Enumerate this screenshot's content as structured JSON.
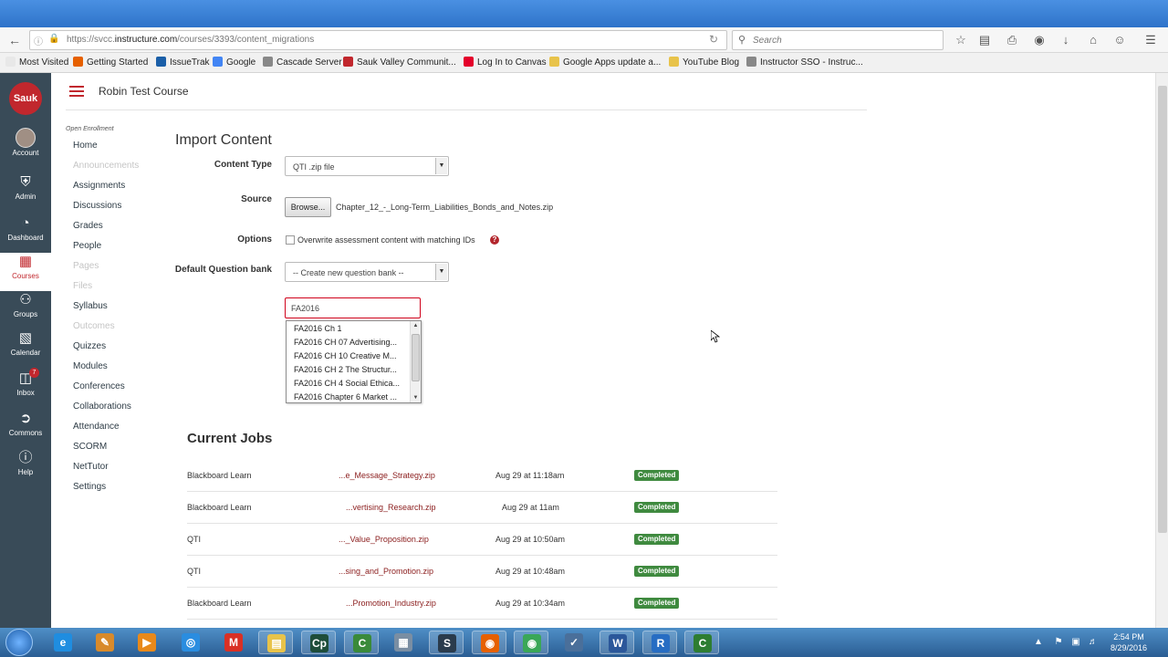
{
  "browser": {
    "url_prefix": "https://svcc.",
    "url_domain": "instructure.com",
    "url_path": "/courses/3393/content_migrations",
    "search_placeholder": "Search"
  },
  "bookmarks": [
    {
      "label": "Most Visited",
      "color": "#e8e8e8"
    },
    {
      "label": "Getting Started",
      "color": "#e66000"
    },
    {
      "label": "IssueTrak",
      "color": "#1b5fa8"
    },
    {
      "label": "Google",
      "color": "#4285f4"
    },
    {
      "label": "Cascade Server",
      "color": "#888888"
    },
    {
      "label": "Sauk Valley Communit...",
      "color": "#c1272d"
    },
    {
      "label": "Log In to Canvas",
      "color": "#e4002b"
    },
    {
      "label": "Google Apps update a...",
      "color": "#e8c34a"
    },
    {
      "label": "YouTube Blog",
      "color": "#e8c34a"
    },
    {
      "label": "Instructor SSO - Instruc...",
      "color": "#888888"
    }
  ],
  "global_nav": {
    "logo": "Sauk",
    "items": [
      {
        "label": "Account",
        "icon": "avatar"
      },
      {
        "label": "Admin",
        "icon": "shield-icon"
      },
      {
        "label": "Dashboard",
        "icon": "dashboard-icon"
      },
      {
        "label": "Courses",
        "icon": "book-icon"
      },
      {
        "label": "Groups",
        "icon": "groups-icon"
      },
      {
        "label": "Calendar",
        "icon": "calendar-icon"
      },
      {
        "label": "Inbox",
        "icon": "inbox-icon",
        "badge": "7"
      },
      {
        "label": "Commons",
        "icon": "commons-icon"
      },
      {
        "label": "Help",
        "icon": "help-icon"
      }
    ],
    "active": "Courses"
  },
  "course": {
    "title": "Robin Test Course",
    "enrollment_label": "Open Enrollment",
    "nav": [
      {
        "label": "Home",
        "disabled": false
      },
      {
        "label": "Announcements",
        "disabled": true
      },
      {
        "label": "Assignments",
        "disabled": false
      },
      {
        "label": "Discussions",
        "disabled": false
      },
      {
        "label": "Grades",
        "disabled": false
      },
      {
        "label": "People",
        "disabled": false
      },
      {
        "label": "Pages",
        "disabled": true
      },
      {
        "label": "Files",
        "disabled": true
      },
      {
        "label": "Syllabus",
        "disabled": false
      },
      {
        "label": "Outcomes",
        "disabled": true
      },
      {
        "label": "Quizzes",
        "disabled": false
      },
      {
        "label": "Modules",
        "disabled": false
      },
      {
        "label": "Conferences",
        "disabled": false
      },
      {
        "label": "Collaborations",
        "disabled": false
      },
      {
        "label": "Attendance",
        "disabled": false
      },
      {
        "label": "SCORM",
        "disabled": false
      },
      {
        "label": "NetTutor",
        "disabled": false
      },
      {
        "label": "Settings",
        "disabled": false
      }
    ]
  },
  "import": {
    "title": "Import Content",
    "content_type_label": "Content Type",
    "content_type_value": "QTI .zip file",
    "source_label": "Source",
    "browse_label": "Browse...",
    "file_name": "Chapter_12_-_Long-Term_Liabilities_Bonds_and_Notes.zip",
    "options_label": "Options",
    "overwrite_label": "Overwrite assessment content with matching IDs",
    "help_glyph": "?",
    "question_bank_label": "Default Question bank",
    "question_bank_value": "-- Create new question bank --",
    "new_bank_value": "FA2016",
    "suggestions": [
      "FA2016 Ch 1",
      "FA2016 CH 07 Advertising...",
      "FA2016 CH 10 Creative M...",
      "FA2016 CH 2 The Structur...",
      "FA2016 CH 4 Social Ethica...",
      "FA2016 Chapter 6 Market ..."
    ]
  },
  "jobs": {
    "title": "Current Jobs",
    "rows": [
      {
        "type": "Blackboard Learn",
        "file": "...e_Message_Strategy.zip",
        "date": "Aug 29 at 11:18am",
        "status": "Completed"
      },
      {
        "type": "Blackboard Learn",
        "file": "...vertising_Research.zip",
        "date": "Aug 29 at 11am",
        "status": "Completed"
      },
      {
        "type": "QTI",
        "file": "..._Value_Proposition.zip",
        "date": "Aug 29 at 10:50am",
        "status": "Completed"
      },
      {
        "type": "QTI",
        "file": "...sing_and_Promotion.zip",
        "date": "Aug 29 at 10:48am",
        "status": "Completed"
      },
      {
        "type": "Blackboard Learn",
        "file": "...Promotion_Industry.zip",
        "date": "Aug 29 at 10:34am",
        "status": "Completed"
      }
    ]
  },
  "taskbar": {
    "apps": [
      {
        "name": "ie-icon",
        "glyph": "e",
        "color": "#1f8de0"
      },
      {
        "name": "paint-icon",
        "glyph": "✎",
        "color": "#d88a2b"
      },
      {
        "name": "media-icon",
        "glyph": "▶",
        "color": "#e8891b"
      },
      {
        "name": "chat-icon",
        "glyph": "◎",
        "color": "#2a8de0"
      },
      {
        "name": "gmail-icon",
        "glyph": "M",
        "color": "#d93025"
      },
      {
        "name": "folder-icon",
        "glyph": "▤",
        "color": "#e8c34a"
      },
      {
        "name": "captivate-icon",
        "glyph": "Cp",
        "color": "#1e4d3a"
      },
      {
        "name": "camtasia-icon",
        "glyph": "C",
        "color": "#3a8a3a"
      },
      {
        "name": "calculator-icon",
        "glyph": "▦",
        "color": "#7a8ea3"
      },
      {
        "name": "snagit-icon",
        "glyph": "S",
        "color": "#2a3b4c"
      },
      {
        "name": "firefox-icon",
        "glyph": "◉",
        "color": "#e66000"
      },
      {
        "name": "chrome-icon",
        "glyph": "◉",
        "color": "#3aa757"
      },
      {
        "name": "notepad-icon",
        "glyph": "✓",
        "color": "#4a6f9a"
      },
      {
        "name": "word-icon",
        "glyph": "W",
        "color": "#2b579a"
      },
      {
        "name": "r-icon",
        "glyph": "R",
        "color": "#276dc3"
      },
      {
        "name": "camtasia-recorder-icon",
        "glyph": "C",
        "color": "#2e7d32"
      }
    ],
    "time": "2:54 PM",
    "date": "8/29/2016"
  }
}
